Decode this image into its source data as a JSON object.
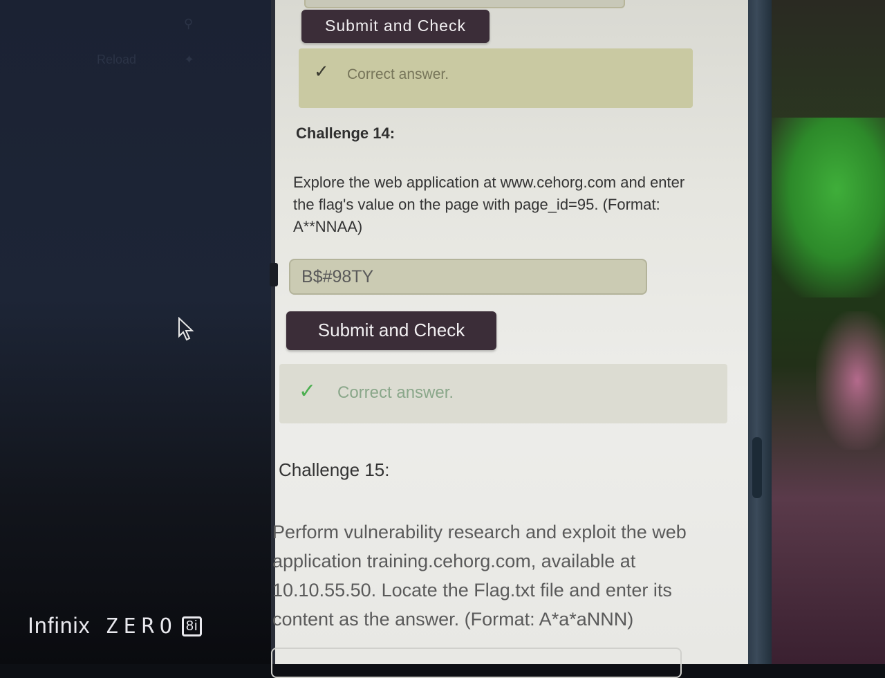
{
  "background": {
    "ghost_reload": "Reload",
    "brand_name": "Infinix",
    "brand_model": "ZERO",
    "brand_badge": "8i"
  },
  "challenge_13": {
    "submit_label": "Submit and Check",
    "feedback": "Correct answer."
  },
  "challenge_14": {
    "title": "Challenge 14:",
    "description": "Explore the web application at www.cehorg.com and enter the flag's value on the page with page_id=95. (Format: A**NNAA)",
    "answer_value": "B$#98TY",
    "submit_label": "Submit and Check",
    "feedback": "Correct answer."
  },
  "challenge_15": {
    "title": "Challenge 15:",
    "description": "Perform vulnerability research and exploit the web application training.cehorg.com, available at 10.10.55.50. Locate the Flag.txt file and enter its content as the answer. (Format: A*a*aNNN)"
  },
  "colors": {
    "button_bg": "#3b2d38",
    "success_check": "#4caf50"
  }
}
